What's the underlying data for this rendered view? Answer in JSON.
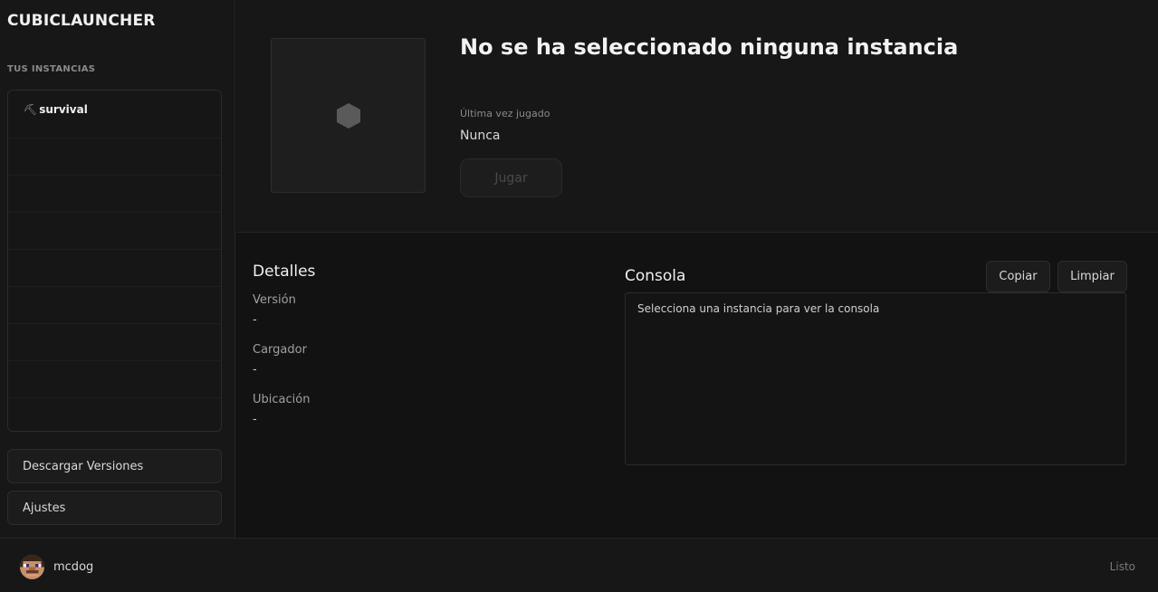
{
  "app": {
    "title": "CUBICLAUNCHER"
  },
  "sidebar": {
    "section_label": "TUS INSTANCIAS",
    "instances": [
      {
        "icon": "⛏",
        "name": "survival"
      }
    ],
    "download_button": "Descargar Versiones",
    "settings_button": "Ajustes"
  },
  "header": {
    "title": "No se ha seleccionado ninguna instancia",
    "last_played_label": "Última vez jugado",
    "last_played_value": "Nunca",
    "play_button": "Jugar"
  },
  "details": {
    "title": "Detalles",
    "version_label": "Versión",
    "version_value": "-",
    "loader_label": "Cargador",
    "loader_value": "-",
    "location_label": "Ubicación",
    "location_value": "-"
  },
  "console": {
    "title": "Consola",
    "copy_button": "Copiar",
    "clear_button": "Limpiar",
    "message": "Selecciona una instancia para ver la consola"
  },
  "footer": {
    "username": "mcdog",
    "status": "Listo"
  }
}
